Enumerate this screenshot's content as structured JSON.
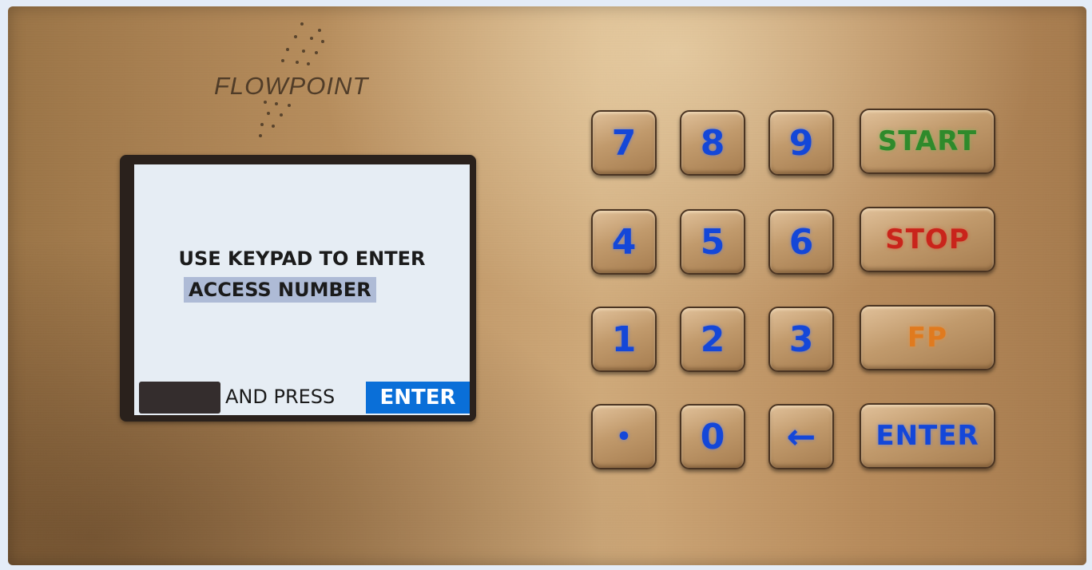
{
  "brand": {
    "name": "FLOWPOINT"
  },
  "screen": {
    "line1": "USE KEYPAD TO ENTER",
    "line2": "ACCESS NUMBER",
    "prompt_text": "AND PRESS",
    "prompt_enter": "ENTER"
  },
  "keypad": {
    "k7": "7",
    "k8": "8",
    "k9": "9",
    "k4": "4",
    "k5": "5",
    "k6": "6",
    "k1": "1",
    "k2": "2",
    "k3": "3",
    "kdot": "•",
    "k0": "0",
    "kback": "←",
    "start": "START",
    "stop": "STOP",
    "fp": "FP",
    "enter": "ENTER"
  },
  "colors": {
    "digit": "#1447d8",
    "start": "#2f8a2b",
    "stop": "#c9241b",
    "fp": "#e07a1e",
    "enter": "#1447d8",
    "lcd_highlight": "#0a6fd8"
  }
}
